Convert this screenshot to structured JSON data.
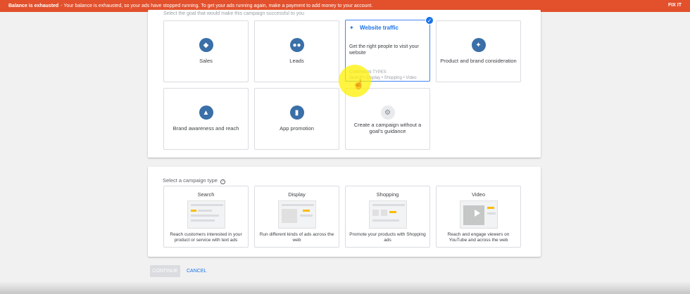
{
  "banner": {
    "bold": "Balance is exhausted",
    "message": "- Your balance is exhausted, so your ads have stopped running. To get your ads running again, make a payment to add money to your account.",
    "fix_label": "FIX IT"
  },
  "goals": {
    "hint": "Select the goal that would make this campaign successful to you",
    "items": [
      {
        "label": "Sales",
        "icon": "tag-icon"
      },
      {
        "label": "Leads",
        "icon": "people-icon"
      },
      {
        "label": "Website traffic",
        "icon": "cursor-click-icon",
        "description": "Get the right people to visit your website",
        "types_heading": "CAMPAIGN TYPES",
        "types": "Search • Display • Shopping • Video",
        "selected": true
      },
      {
        "label": "Product and brand consideration",
        "icon": "sparkle-icon"
      },
      {
        "label": "Brand awareness and reach",
        "icon": "speaker-icon"
      },
      {
        "label": "App promotion",
        "icon": "phone-icon"
      },
      {
        "label": "Create a campaign without a goal's guidance",
        "icon": "gear-icon"
      }
    ]
  },
  "campaign_type": {
    "title": "Select a campaign type",
    "items": [
      {
        "name": "Search",
        "description": "Reach customers interested in your product or service with text ads"
      },
      {
        "name": "Display",
        "description": "Run different kinds of ads across the web"
      },
      {
        "name": "Shopping",
        "description": "Promote your products with Shopping ads"
      },
      {
        "name": "Video",
        "description": "Reach and engage viewers on YouTube and across the web"
      }
    ]
  },
  "actions": {
    "continue_label": "CONTINUE",
    "cancel_label": "CANCEL"
  },
  "colors": {
    "banner": "#e2502c",
    "accent": "#1a73e8",
    "icon_circle": "#3a6fa8"
  }
}
